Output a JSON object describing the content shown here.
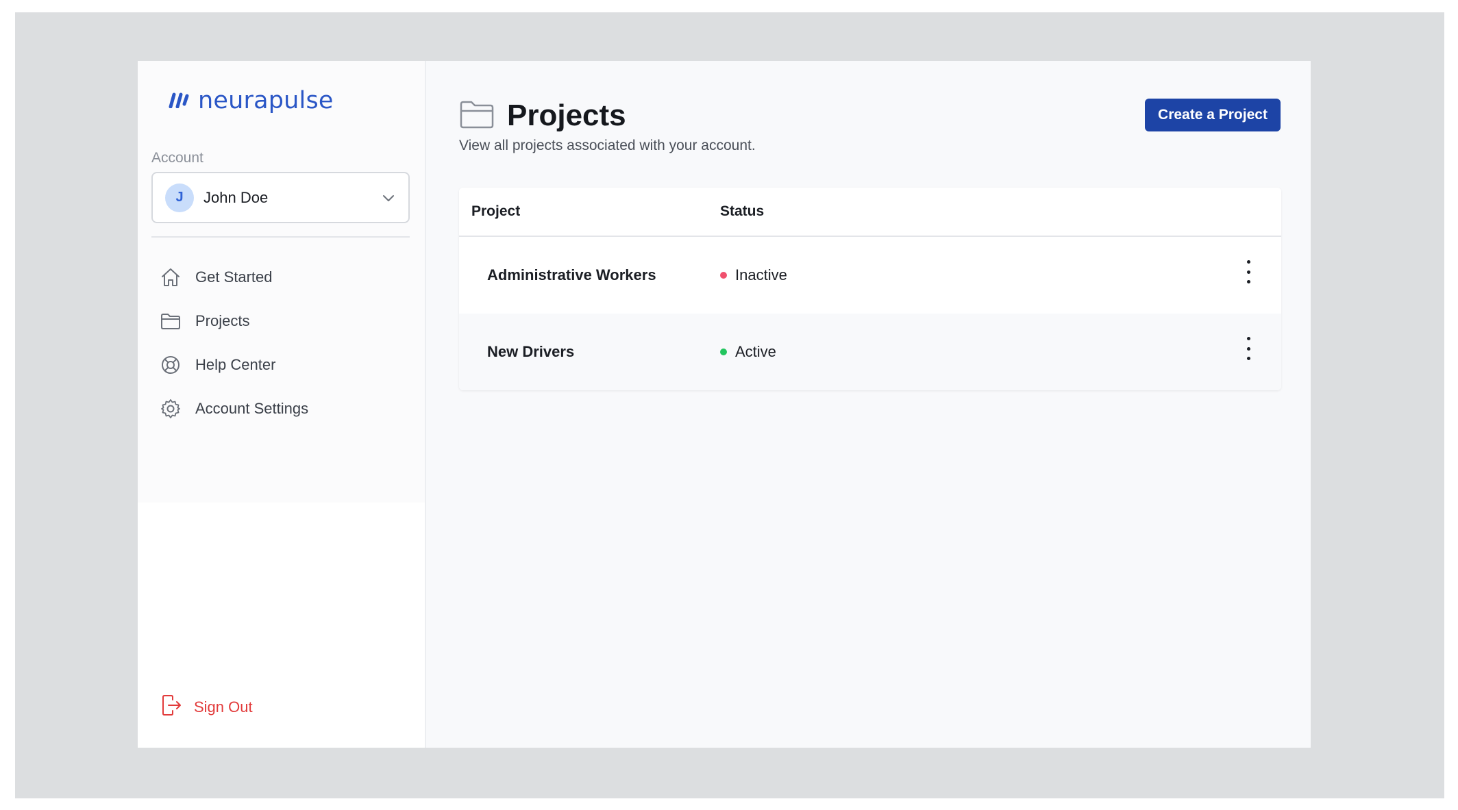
{
  "brand": {
    "name": "neurapulse",
    "color": "#2a56c6"
  },
  "account": {
    "label": "Account",
    "user_name": "John Doe",
    "avatar_initial": "J"
  },
  "sidebar": {
    "items": [
      {
        "label": "Get Started",
        "icon": "home-icon"
      },
      {
        "label": "Projects",
        "icon": "folder-icon"
      },
      {
        "label": "Help Center",
        "icon": "lifebuoy-icon"
      },
      {
        "label": "Account Settings",
        "icon": "gear-icon"
      }
    ],
    "sign_out": {
      "label": "Sign Out",
      "icon": "sign-out-icon",
      "color": "#e23b3b"
    }
  },
  "main": {
    "title": "Projects",
    "subtitle": "View all projects associated with your account.",
    "create_button": "Create a Project",
    "create_button_color": "#1d44a6"
  },
  "table": {
    "columns": [
      "Project",
      "Status"
    ],
    "rows": [
      {
        "project": "Administrative Workers",
        "status": "Inactive",
        "status_color": "#f0506e"
      },
      {
        "project": "New Drivers",
        "status": "Active",
        "status_color": "#22c55e"
      }
    ]
  }
}
